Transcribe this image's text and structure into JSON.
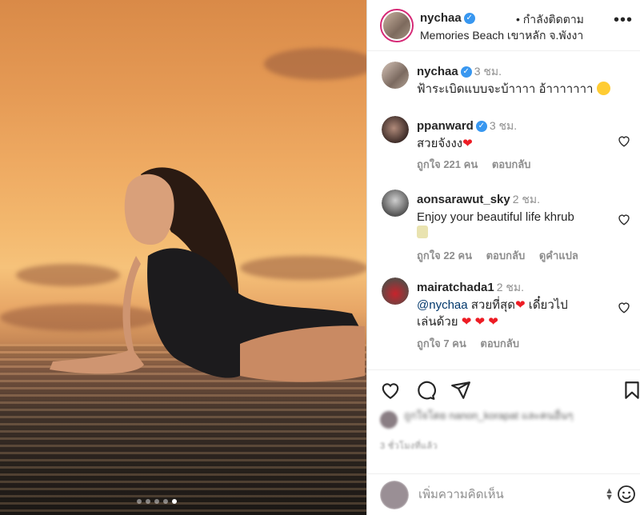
{
  "post": {
    "username": "nychaa",
    "follow_status": "• กำลังติดตาม",
    "location": "Memories Beach เขาหลัก จ.พังงา",
    "carousel_total": 5,
    "carousel_active": 5
  },
  "caption": {
    "username": "nychaa",
    "time": "3 ชม.",
    "text": "ฟ้าระเบิดแบบจะบ้าาาา อ้าาาาาาา"
  },
  "comments": [
    {
      "username": "ppanward",
      "time": "3 ชม.",
      "text": "สวยจังงง",
      "likes": "ถูกใจ 221 คน",
      "reply": "ตอบกลับ"
    },
    {
      "username": "aonsarawut_sky",
      "time": "2 ชม.",
      "text": "Enjoy your beautiful life khrub",
      "likes": "ถูกใจ 22 คน",
      "reply": "ตอบกลับ",
      "translate": "ดูคำแปล"
    },
    {
      "username": "mairatchada1",
      "time": "2 ชม.",
      "mention": "@nychaa",
      "text_a": "สวยที่สุด",
      "text_b": "เดี๋ยวไป",
      "text_c": "เล่นด้วย",
      "likes": "ถูกใจ 7 คน",
      "reply": "ตอบกลับ"
    }
  ],
  "liked_by": "ถูกใจโดย nanon_korapat และคนอื่นๆ",
  "post_time": "3 ชั่วโมงที่แล้ว",
  "add_comment": {
    "placeholder": "เพิ่มความคิดเห็น"
  },
  "colors": {
    "verified": "#3897f0",
    "heart_red": "#ed1c24",
    "mention": "#00376b",
    "muted": "#8e8e8e",
    "story_ring": "#d62976"
  },
  "icons": [
    "more-icon",
    "heart-icon",
    "comment-icon",
    "share-icon",
    "bookmark-icon",
    "emoji-icon",
    "verified-badge-icon"
  ]
}
